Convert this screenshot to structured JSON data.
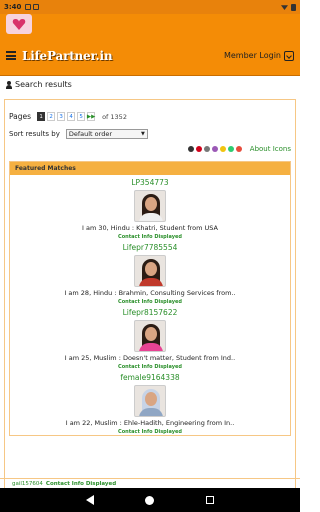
{
  "status_bar": {
    "time": "3:40"
  },
  "header": {
    "brand": "LifePartner.in",
    "member_login": "Member Login"
  },
  "search_results_label": "Search results",
  "pagination": {
    "label": "Pages",
    "pages": [
      "1",
      "2",
      "3",
      "4",
      "5"
    ],
    "next": "▶▶",
    "of_label": "of 1352"
  },
  "sort": {
    "label": "Sort results by",
    "selected": "Default order"
  },
  "about_icons": "About Icons",
  "featured": {
    "title": "Featured Matches",
    "matches": [
      {
        "id": "LP354773",
        "desc": "I am 30, Hindu : Khatri, Student from USA",
        "contact": "Contact Info Displayed",
        "shirt": "#f0f0f0"
      },
      {
        "id": "Lifepr7785554",
        "desc": "I am 28, Hindu : Brahmin, Consulting Services from..",
        "contact": "Contact Info Displayed",
        "shirt": "#c0392b"
      },
      {
        "id": "Lifepr8157622",
        "desc": "I am 25, Muslim : Doesn't matter, Student from Ind..",
        "contact": "Contact Info Displayed",
        "shirt": "#e84393"
      },
      {
        "id": "female9164338",
        "desc": "I am 22, Muslim : Ehle-Hadith, Engineering from In..",
        "contact": "Contact Info Displayed",
        "shirt": "#8fa6c4"
      }
    ]
  },
  "bottom_item": {
    "id": "gail157604",
    "tag": "Contact Info Displayed"
  }
}
